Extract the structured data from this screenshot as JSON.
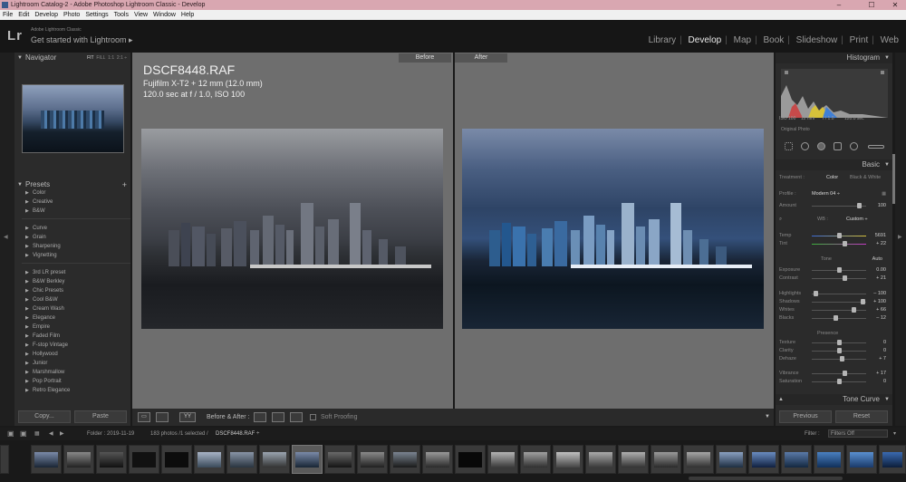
{
  "window": {
    "title": "Lightroom Catalog-2 - Adobe Photoshop Lightroom Classic - Develop",
    "minimize": "–",
    "maximize": "☐",
    "close": "✕"
  },
  "menu": [
    "File",
    "Edit",
    "Develop",
    "Photo",
    "Settings",
    "Tools",
    "View",
    "Window",
    "Help"
  ],
  "identity": {
    "logo": "Lr",
    "app": "Adobe Lightroom Classic",
    "tagline": "Get started with Lightroom ▸"
  },
  "modules": [
    "Library",
    "Develop",
    "Map",
    "Book",
    "Slideshow",
    "Print",
    "Web"
  ],
  "active_module": "Develop",
  "navigator": {
    "title": "Navigator",
    "zoom": [
      "FIT",
      "FILL",
      "1:1",
      "2:1 ÷"
    ]
  },
  "presets": {
    "title": "Presets",
    "add": "+",
    "items": [
      "Color",
      "Creative",
      "B&W",
      "Curve",
      "Grain",
      "Sharpening",
      "Vignetting",
      "3rd LR preset",
      "B&W Berkley",
      "Chic Presets",
      "Cool B&W",
      "Cream Wash",
      "Elegance",
      "Empire",
      "Faded Film",
      "F-stop Vintage",
      "Hollywood",
      "Junior",
      "Marshmallow",
      "Pop Portrait",
      "Retro Elegance"
    ]
  },
  "left_buttons": {
    "copy": "Copy...",
    "paste": "Paste"
  },
  "image": {
    "filename": "DSCF8448.RAF",
    "camera": "Fujifilm X-T2 + 12 mm (12.0 mm)",
    "exposure": "120.0 sec at f / 1.0, ISO 100"
  },
  "view_labels": {
    "before": "Before",
    "after": "After"
  },
  "toolbar": {
    "view_btn": "▭",
    "yy_btn": "YY",
    "before_after_label": "Before & After :",
    "soft_proofing": "Soft Proofing"
  },
  "histogram": {
    "title": "Histogram",
    "readout": [
      "ISO 100",
      "12 mm",
      "f / 1.0",
      "120.0 sec"
    ],
    "original_photo": "Original Photo"
  },
  "basic": {
    "title": "Basic",
    "treatment_label": "Treatment :",
    "treatment_color": "Color",
    "treatment_bw": "Black & White",
    "profile_label": "Profile :",
    "profile_value": "Modern 04 ÷",
    "amount_label": "Amount",
    "amount_value": "100",
    "wb_label": "WB :",
    "wb_value": "Custom ÷",
    "temp": {
      "label": "Temp",
      "value": "5691"
    },
    "tint": {
      "label": "Tint",
      "value": "+ 22"
    },
    "tone_label": "Tone",
    "auto_label": "Auto",
    "exposure": {
      "label": "Exposure",
      "value": "0.00"
    },
    "contrast": {
      "label": "Contrast",
      "value": "+ 21"
    },
    "highlights": {
      "label": "Highlights",
      "value": "– 100"
    },
    "shadows": {
      "label": "Shadows",
      "value": "+ 100"
    },
    "whites": {
      "label": "Whites",
      "value": "+ 66"
    },
    "blacks": {
      "label": "Blacks",
      "value": "– 12"
    },
    "presence_label": "Presence",
    "texture": {
      "label": "Texture",
      "value": "0"
    },
    "clarity": {
      "label": "Clarity",
      "value": "0"
    },
    "dehaze": {
      "label": "Dehaze",
      "value": "+ 7"
    },
    "vibrance": {
      "label": "Vibrance",
      "value": "+ 17"
    },
    "saturation": {
      "label": "Saturation",
      "value": "0"
    }
  },
  "tone_curve": {
    "title": "Tone Curve"
  },
  "right_buttons": {
    "previous": "Previous",
    "reset": "Reset"
  },
  "filmstrip_header": {
    "folder": "Folder : 2019-11-19",
    "count": "183 photos /1 selected /",
    "selected_file": "DSCF8448.RAF ÷",
    "filter_label": "Filter :",
    "filter_value": "Filters Off"
  }
}
